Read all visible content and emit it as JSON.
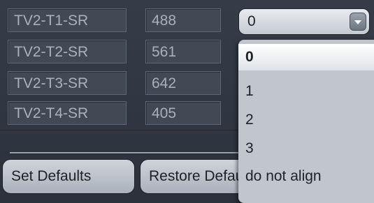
{
  "rows": [
    {
      "name": "TV2-T1-SR",
      "value": "488"
    },
    {
      "name": "TV2-T2-SR",
      "value": "561"
    },
    {
      "name": "TV2-T3-SR",
      "value": "642"
    },
    {
      "name": "TV2-T4-SR",
      "value": "405"
    }
  ],
  "alignment_select": {
    "selected": "0",
    "options": [
      "0",
      "1",
      "2",
      "3",
      "do not align"
    ]
  },
  "buttons": {
    "set_defaults": "Set Defaults",
    "restore_defaults": "Restore Defaults"
  }
}
